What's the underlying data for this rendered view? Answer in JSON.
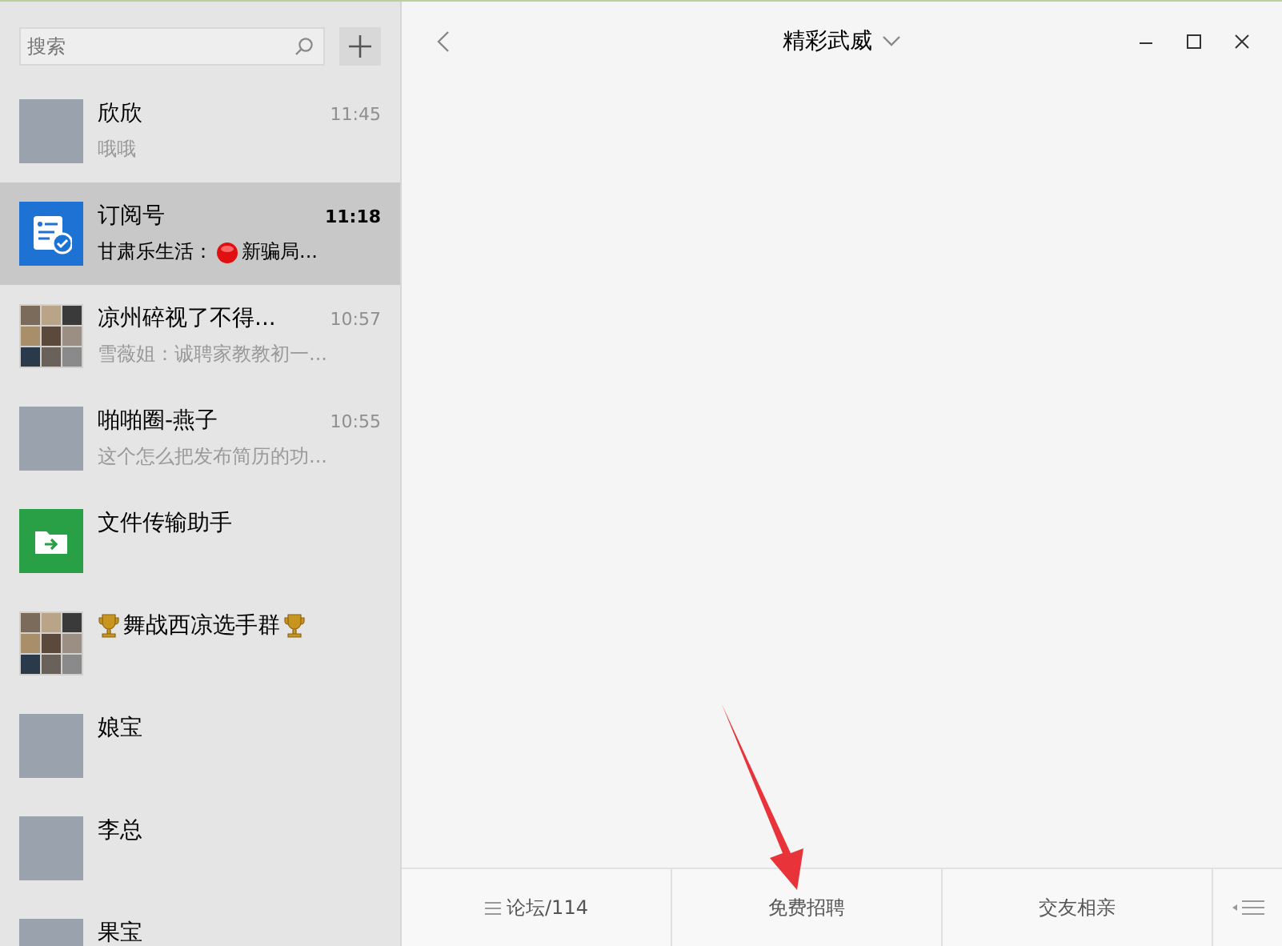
{
  "search": {
    "placeholder": "搜索"
  },
  "chats": [
    {
      "kind": "photo",
      "name": "欣欣",
      "trophies": false,
      "preview": [
        {
          "kind": "text",
          "text": "哦哦"
        }
      ],
      "time": "11:45",
      "selected": false
    },
    {
      "kind": "subscription",
      "name": "订阅号",
      "trophies": false,
      "preview": [
        {
          "kind": "text",
          "text": "甘肃乐生活："
        },
        {
          "kind": "emoji"
        },
        {
          "kind": "text",
          "text": "新骗局..."
        }
      ],
      "time": "11:18",
      "selected": true
    },
    {
      "kind": "group",
      "name": "凉州碎视了不得...",
      "trophies": false,
      "preview": [
        {
          "kind": "text",
          "text": "雪薇姐：诚聘家教教初一..."
        }
      ],
      "time": "10:57",
      "selected": false
    },
    {
      "kind": "photo",
      "name": "啪啪圈-燕子",
      "trophies": false,
      "preview": [
        {
          "kind": "text",
          "text": "这个怎么把发布简历的功..."
        }
      ],
      "time": "10:55",
      "selected": false
    },
    {
      "kind": "file",
      "name": "文件传输助手",
      "trophies": false,
      "selected": false
    },
    {
      "kind": "group",
      "name": "舞战西凉选手群",
      "trophies": true,
      "selected": false
    },
    {
      "kind": "photo",
      "name": "娘宝",
      "trophies": false,
      "selected": false
    },
    {
      "kind": "photo",
      "name": "李总",
      "trophies": false,
      "selected": false
    },
    {
      "kind": "photo",
      "name": "果宝",
      "trophies": false,
      "selected": false
    }
  ],
  "chat": {
    "title": "精彩武威"
  },
  "menu": [
    {
      "label": "论坛/114",
      "has_list_icon": true
    },
    {
      "label": "免费招聘",
      "has_list_icon": false
    },
    {
      "label": "交友相亲",
      "has_list_icon": false
    }
  ]
}
